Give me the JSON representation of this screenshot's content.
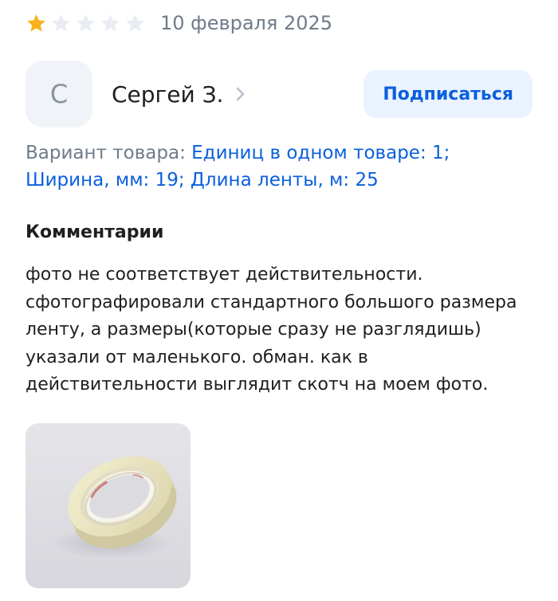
{
  "review": {
    "rating": 1,
    "max_rating": 5,
    "date": "10 февраля 2025",
    "colors": {
      "star_active": "#f9b21c",
      "star_inactive": "#e9edf3",
      "accent": "#0b5fdd",
      "muted": "#6f7b8a"
    }
  },
  "author": {
    "initial": "С",
    "name": "Сергей З.",
    "icons": {
      "chevron": "chevron-right-icon"
    },
    "subscribe_label": "Подписаться"
  },
  "variant": {
    "label": "Вариант товара: ",
    "value": "Единиц в одном товаре: 1; Ширина, мм: 19; Длина ленты, м: 25"
  },
  "comments": {
    "title": "Комментарии",
    "text": "фото не соответствует действительности. сфотографировали стандартного большого размера ленту, а размеры(которые сразу не разглядишь) указали от маленького.  обман. как в действительности выглядит скотч на моем фото."
  },
  "photo": {
    "subject": "roll-of-masking-tape"
  }
}
